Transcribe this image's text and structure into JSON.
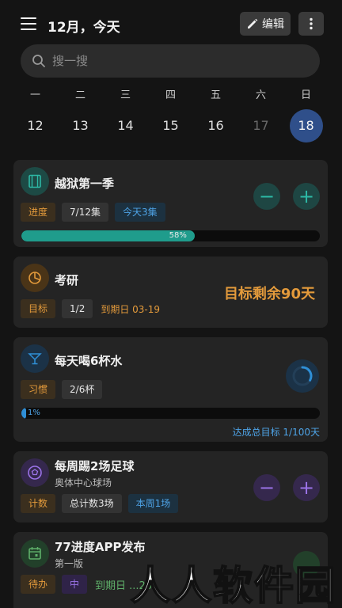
{
  "header": {
    "title": "12月，今天",
    "edit_label": "编辑"
  },
  "search": {
    "placeholder": "搜一搜"
  },
  "week": {
    "days": [
      {
        "dow": "一",
        "date": "12"
      },
      {
        "dow": "二",
        "date": "13"
      },
      {
        "dow": "三",
        "date": "14"
      },
      {
        "dow": "四",
        "date": "15"
      },
      {
        "dow": "五",
        "date": "16"
      },
      {
        "dow": "六",
        "date": "17"
      },
      {
        "dow": "日",
        "date": "18"
      }
    ],
    "selected": "18"
  },
  "cards": [
    {
      "title": "越狱第一季",
      "icon": "film-icon",
      "chips": [
        "进度",
        "7/12集",
        "今天3集"
      ],
      "progress_percent": 58,
      "progress_label": "58%",
      "accent": "#1f9c8c"
    },
    {
      "title": "考研",
      "icon": "pie-chart-icon",
      "chips": [
        "目标",
        "1/2"
      ],
      "due": "到期日 03-19",
      "goal_text": "目标剩余90天",
      "accent": "#e39a3b"
    },
    {
      "title": "每天喝6杯水",
      "icon": "cocktail-icon",
      "chips": [
        "习惯",
        "2/6杯"
      ],
      "progress_percent": 1,
      "progress_label": "1%",
      "total_goal": "达成总目标 1/100天",
      "ring_progress": 0.33,
      "accent": "#2f8fd6"
    },
    {
      "title": "每周踢2场足球",
      "subtitle": "奥体中心球场",
      "icon": "football-icon",
      "chips": [
        "计数",
        "总计数3场",
        "本周1场"
      ],
      "accent": "#9b73e8"
    },
    {
      "title": "77进度APP发布",
      "subtitle": "第一版",
      "icon": "calendar-icon",
      "chips": [
        "待办",
        "中"
      ],
      "due": "到期日 ...20",
      "accent": "#5fb06a"
    }
  ],
  "watermark": "人人软件园"
}
